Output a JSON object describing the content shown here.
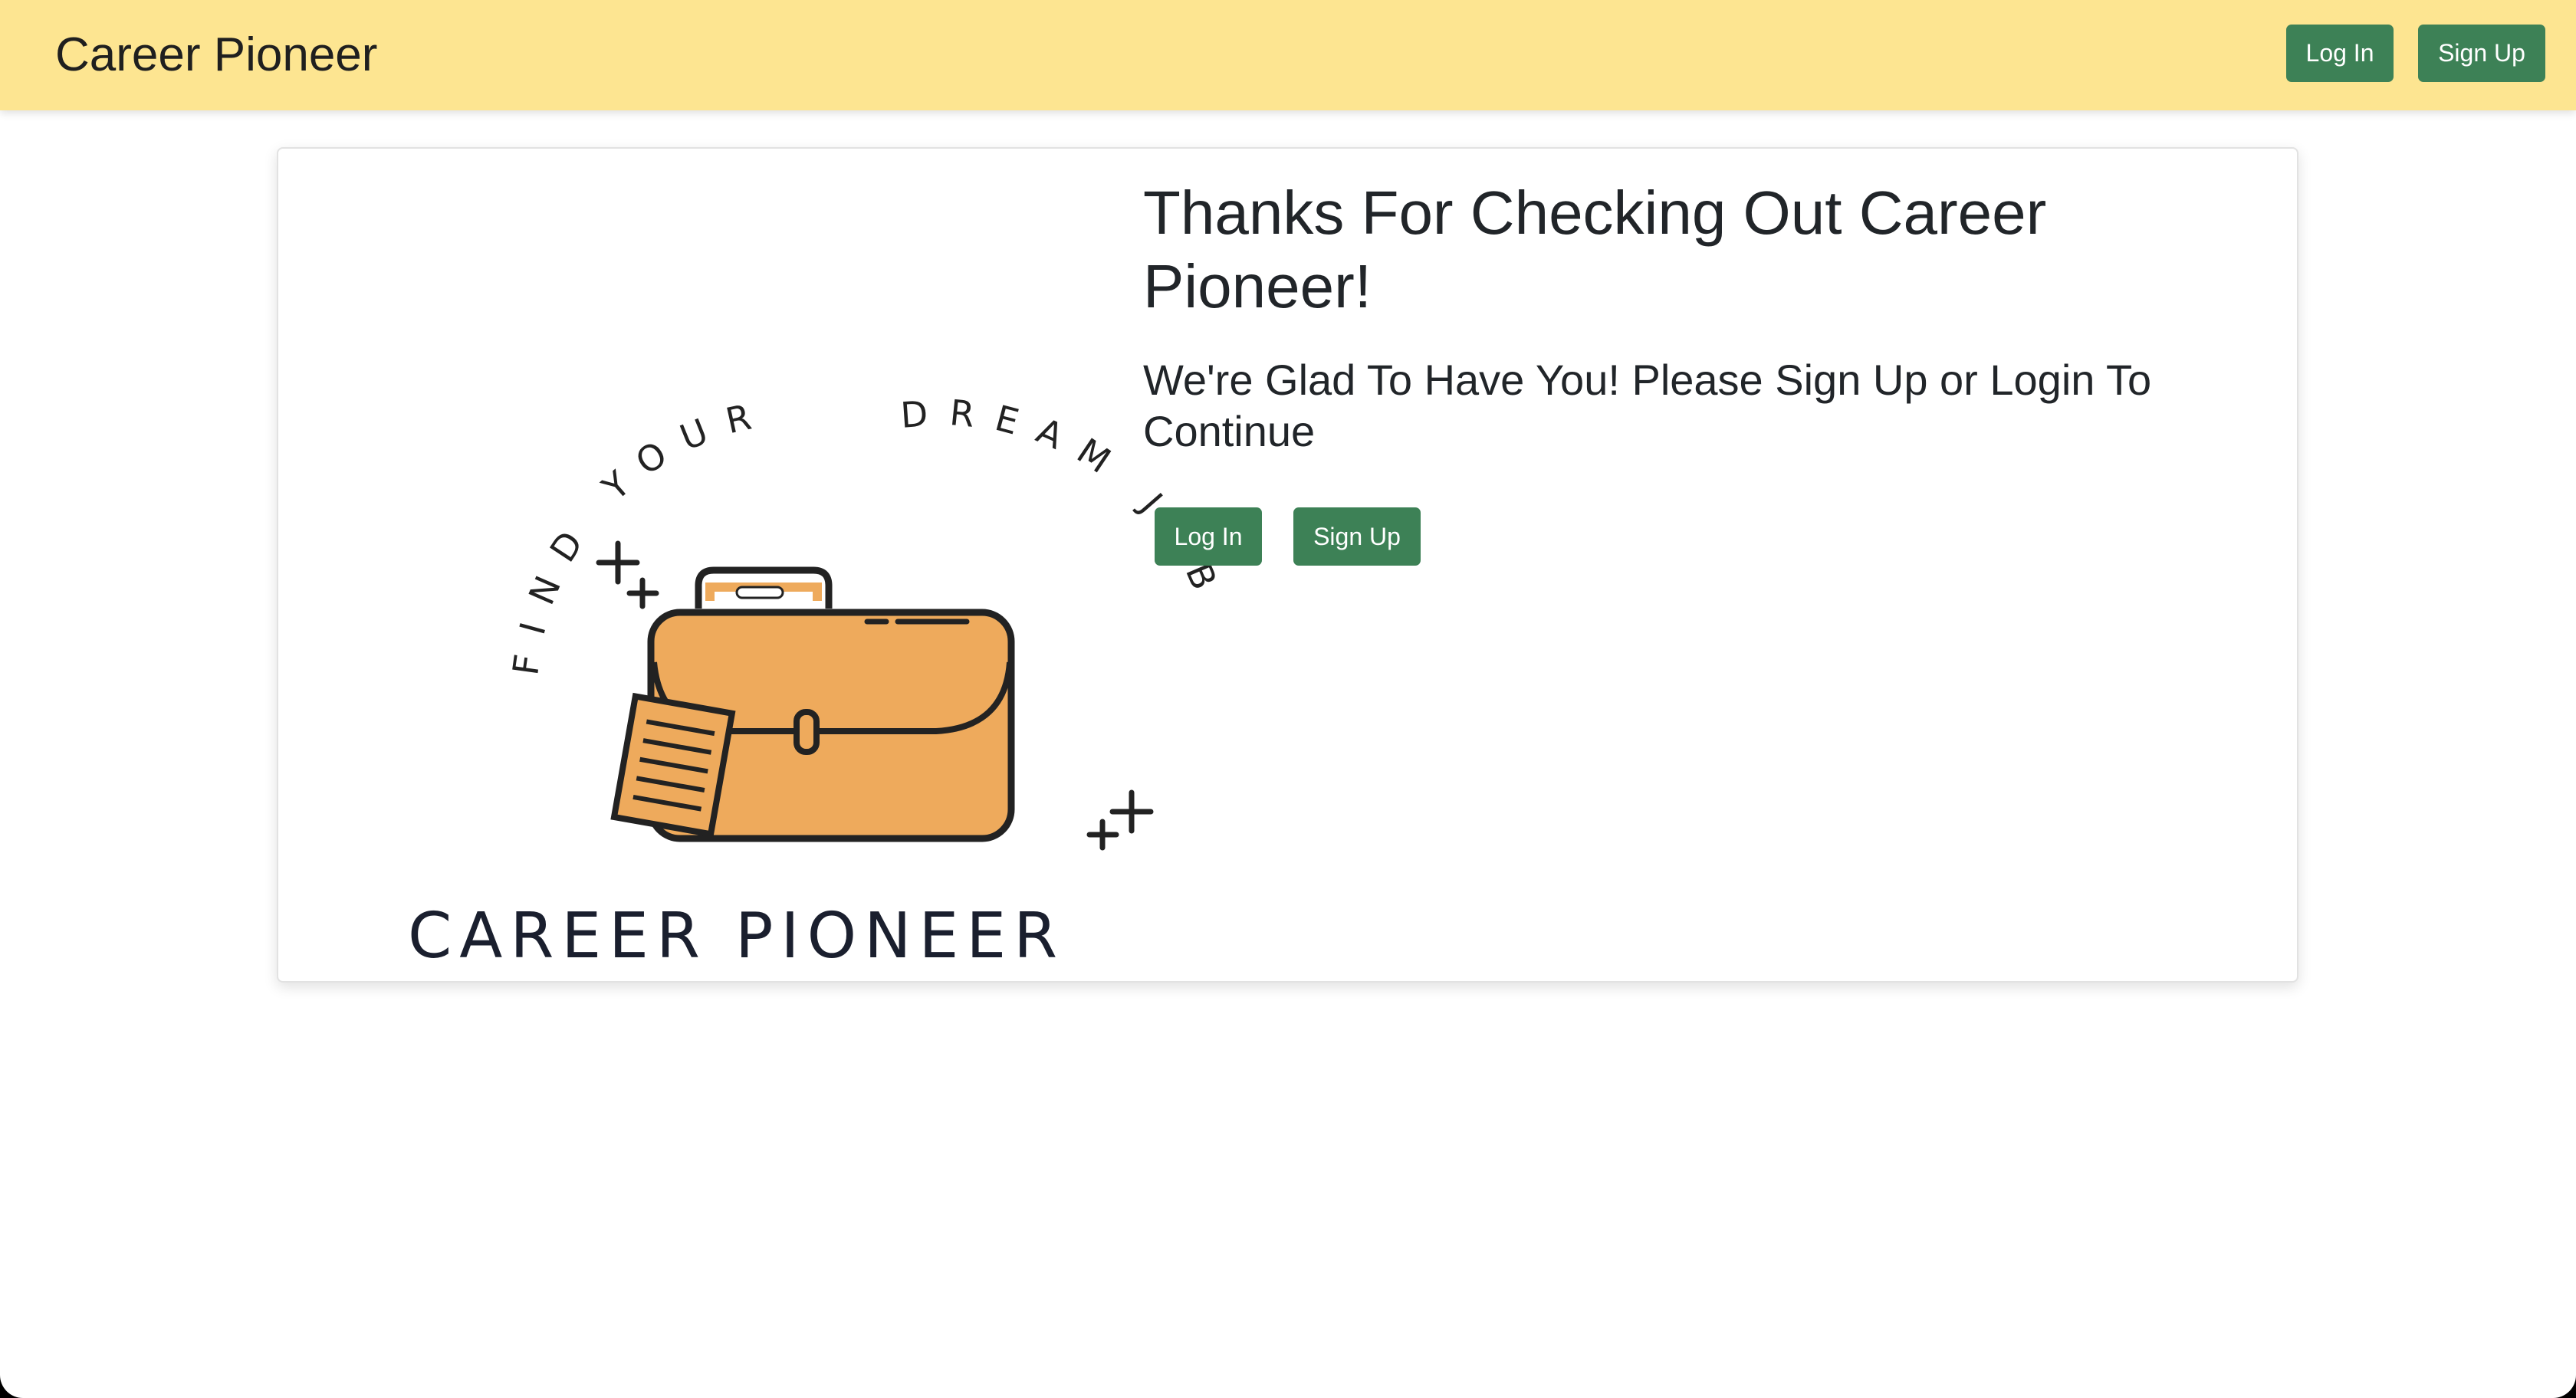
{
  "navbar": {
    "brand": "Career Pioneer",
    "login_label": "Log In",
    "signup_label": "Sign Up"
  },
  "main": {
    "heading": "Thanks For Checking Out Career Pioneer!",
    "subheading": "We're Glad To Have You! Please Sign Up or Login To Continue",
    "login_label": "Log In",
    "signup_label": "Sign Up",
    "logo": {
      "arc_text": "FIND YOUR DREAM JOB",
      "wordmark": "CAREER PIONEER",
      "icon": "briefcase-icon"
    }
  },
  "colors": {
    "navbar_bg": "#fde591",
    "button_bg": "#3d8156",
    "button_text": "#ffffff",
    "text": "#212529",
    "briefcase": "#eeaa5c"
  }
}
